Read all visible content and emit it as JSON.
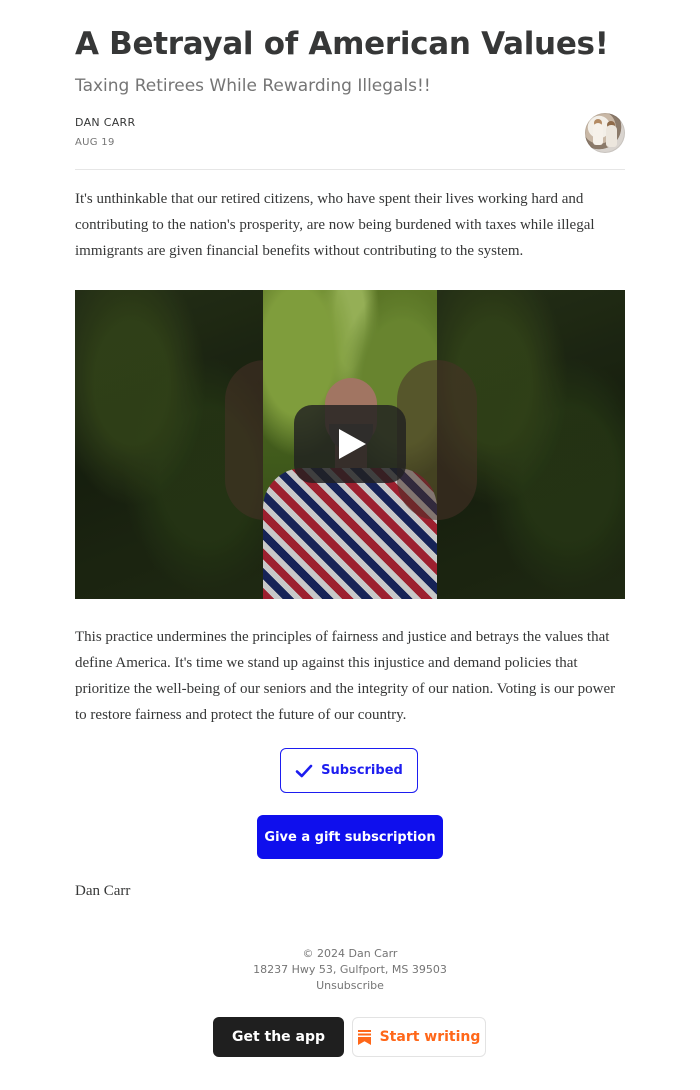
{
  "post": {
    "title": "A Betrayal of American Values!",
    "subtitle": "Taxing Retirees While Rewarding Illegals!!",
    "author": "DAN CARR",
    "date": "AUG 19",
    "paragraph_1": "It's unthinkable that our retired citizens, who have spent their lives working hard and contributing to the nation's prosperity, are now being burdened with taxes while illegal immigrants are given financial benefits without contributing to the system.",
    "paragraph_2": "This practice undermines the principles of fairness and justice and betrays the values that define America. It's time we stand up against this injustice and demand policies that prioritize the well-being of our seniors and the integrity of our nation. Voting is our power to restore fairness and protect the future of our country.",
    "signoff": "Dan Carr"
  },
  "buttons": {
    "subscribed": "Subscribed",
    "gift": "Give a gift subscription",
    "get_app": "Get the app",
    "start_writing": "Start writing"
  },
  "footer": {
    "copyright": "© 2024 Dan Carr",
    "address": "18237 Hwy 53, Gulfport, MS 39503",
    "unsubscribe": "Unsubscribe"
  },
  "icons": {
    "play": "play-icon",
    "check": "check-icon",
    "substack": "substack-icon",
    "avatar": "author-avatar"
  },
  "colors": {
    "accent_blue": "#0f0fed",
    "substack_orange": "#ff6719",
    "text": "#363737",
    "muted": "#757575"
  }
}
